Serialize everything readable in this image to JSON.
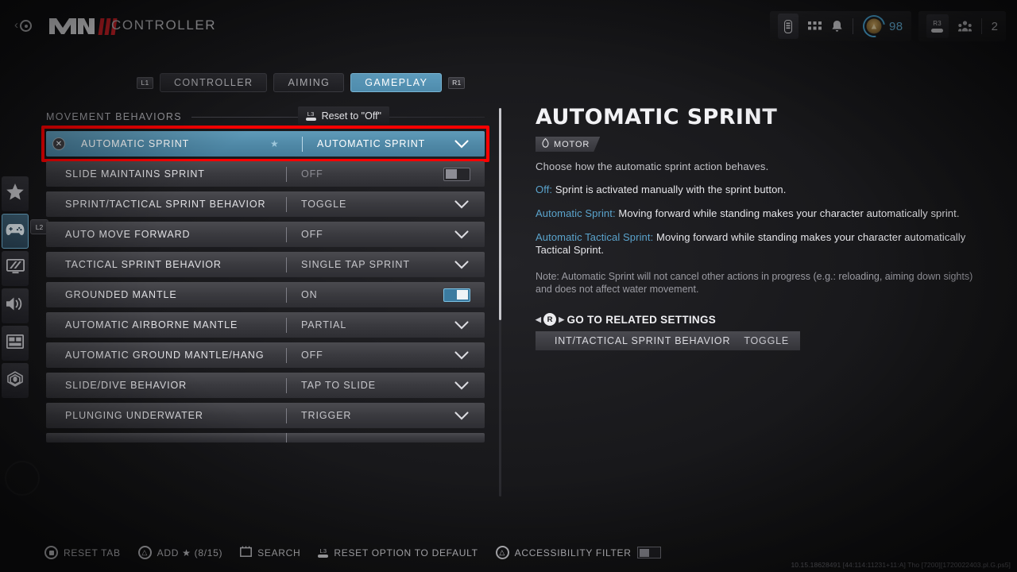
{
  "header": {
    "back_icon": "back-arrow-icon",
    "logo_text": "MW",
    "title": "CONTROLLER"
  },
  "hud": {
    "battery_icon": "battery-icon",
    "grid_icon": "apps-grid-icon",
    "bell_icon": "notification-bell-icon",
    "currency_value": "98",
    "r3_label": "R3",
    "party_count": "2"
  },
  "tabs": {
    "left_bumper": "L1",
    "right_bumper": "R1",
    "items": [
      {
        "label": "CONTROLLER",
        "active": false
      },
      {
        "label": "AIMING",
        "active": false
      },
      {
        "label": "GAMEPLAY",
        "active": true
      }
    ]
  },
  "sidebar": {
    "badge": "L2",
    "items": [
      {
        "name": "favorites",
        "icon": "star-icon",
        "active": false
      },
      {
        "name": "controller",
        "icon": "gamepad-icon",
        "active": true
      },
      {
        "name": "graphics",
        "icon": "monitor-icon",
        "active": false
      },
      {
        "name": "audio",
        "icon": "speaker-icon",
        "active": false
      },
      {
        "name": "interface",
        "icon": "layout-icon",
        "active": false
      },
      {
        "name": "accessibility",
        "icon": "accessibility-icon",
        "active": false
      }
    ]
  },
  "list": {
    "section_title": "MOVEMENT BEHAVIORS",
    "reset_chip": {
      "prompt": "L3",
      "label": "Reset to \"Off\""
    },
    "rows": [
      {
        "label": "AUTOMATIC SPRINT",
        "value": "AUTOMATIC SPRINT",
        "control": "dropdown",
        "selected": true,
        "favorited": true,
        "prompt_icon": "ps-cross-icon"
      },
      {
        "label": "SLIDE MAINTAINS SPRINT",
        "value": "OFF",
        "control": "toggle",
        "toggle_state": "off"
      },
      {
        "label": "SPRINT/TACTICAL SPRINT BEHAVIOR",
        "value": "TOGGLE",
        "control": "dropdown"
      },
      {
        "label": "AUTO MOVE FORWARD",
        "value": "OFF",
        "control": "dropdown"
      },
      {
        "label": "TACTICAL SPRINT BEHAVIOR",
        "value": "SINGLE TAP SPRINT",
        "control": "dropdown"
      },
      {
        "label": "GROUNDED MANTLE",
        "value": "ON",
        "control": "toggle",
        "toggle_state": "on"
      },
      {
        "label": "AUTOMATIC AIRBORNE MANTLE",
        "value": "PARTIAL",
        "control": "dropdown"
      },
      {
        "label": "AUTOMATIC GROUND MANTLE/HANG",
        "value": "OFF",
        "control": "dropdown"
      },
      {
        "label": "SLIDE/DIVE BEHAVIOR",
        "value": "TAP TO SLIDE",
        "control": "dropdown"
      },
      {
        "label": "PLUNGING UNDERWATER",
        "value": "TRIGGER",
        "control": "dropdown"
      }
    ]
  },
  "detail": {
    "title": "AUTOMATIC SPRINT",
    "badge": {
      "icon": "hand-icon",
      "label": "MOTOR"
    },
    "lead": "Choose how the automatic sprint action behaves.",
    "options": [
      {
        "name": "Off:",
        "desc": " Sprint is activated manually with the sprint button."
      },
      {
        "name": "Automatic Sprint:",
        "desc": " Moving forward while standing makes your character automatically sprint."
      },
      {
        "name": "Automatic Tactical Sprint:",
        "desc": " Moving forward while standing makes your character automatically Tactical Sprint."
      }
    ],
    "note": "Note: Automatic Sprint will not cancel other actions in progress (e.g.: reloading, aiming down sights) and does not affect water movement.",
    "related": {
      "prompt": "R",
      "heading": "GO TO RELATED SETTINGS",
      "row_label": "INT/TACTICAL SPRINT BEHAVIOR",
      "row_value": "TOGGLE"
    }
  },
  "bottombar": {
    "items": [
      {
        "prompt": "ps-options-icon",
        "label": "RESET TAB",
        "toggle": false
      },
      {
        "prompt": "ps-triangle-icon",
        "label": "ADD ★ (8/15)",
        "toggle": false
      },
      {
        "prompt": "search-icon",
        "label": "SEARCH",
        "toggle": false
      },
      {
        "prompt": "L3",
        "label": "RESET OPTION TO DEFAULT",
        "toggle": false
      },
      {
        "prompt": "ps-triangle-icon",
        "label": "ACCESSIBILITY FILTER",
        "toggle": true
      }
    ]
  },
  "version": "10.15.18628491 [44:114:11231+11:A] Tho [7200][1720022403.pl.G.ps5]",
  "colors": {
    "accent": "#4e8bac",
    "highlight_border": "#ff0000",
    "link": "#5aa3cc",
    "logo_red": "#d32128"
  }
}
